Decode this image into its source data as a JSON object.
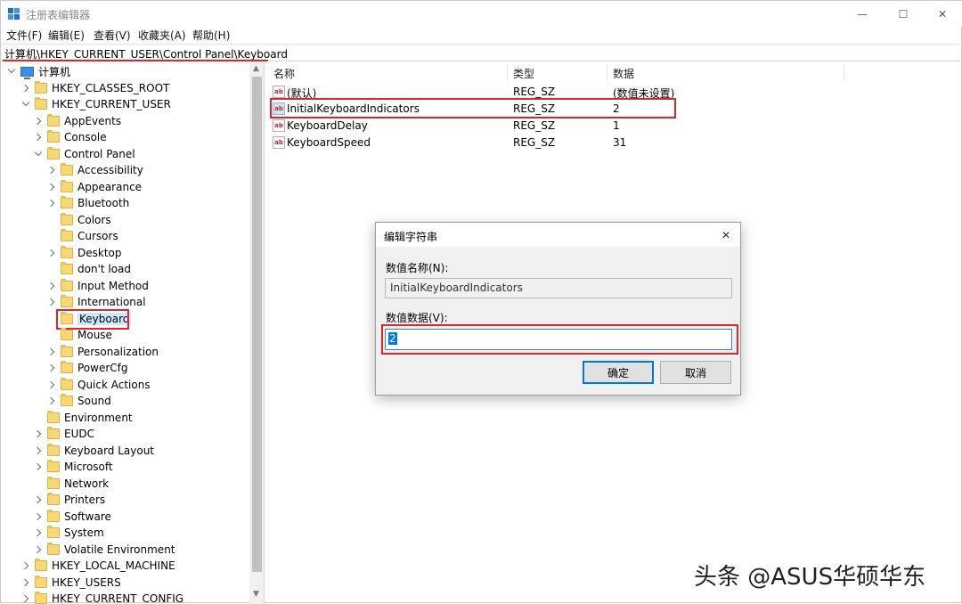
{
  "window": {
    "title": "注册表编辑器",
    "controls": {
      "minimize": "—",
      "maximize": "☐",
      "close": "✕"
    }
  },
  "menubar": {
    "items": [
      "文件(F)",
      "编辑(E)",
      "查看(V)",
      "收藏夹(A)",
      "帮助(H)"
    ]
  },
  "address": "计算机\\HKEY_CURRENT_USER\\Control Panel\\Keyboard",
  "tree": {
    "root": "计算机",
    "items": [
      "HKEY_CLASSES_ROOT",
      "HKEY_CURRENT_USER",
      "AppEvents",
      "Console",
      "Control Panel",
      "Accessibility",
      "Appearance",
      "Bluetooth",
      "Colors",
      "Cursors",
      "Desktop",
      "don't load",
      "Input Method",
      "International",
      "Keyboard",
      "Mouse",
      "Personalization",
      "PowerCfg",
      "Quick Actions",
      "Sound",
      "Environment",
      "EUDC",
      "Keyboard Layout",
      "Microsoft",
      "Network",
      "Printers",
      "Software",
      "System",
      "Volatile Environment",
      "HKEY_LOCAL_MACHINE",
      "HKEY_USERS",
      "HKEY_CURRENT_CONFIG"
    ],
    "selected": "Keyboard"
  },
  "list": {
    "columns": [
      "名称",
      "类型",
      "数据"
    ],
    "rows": [
      {
        "name": "(默认)",
        "type": "REG_SZ",
        "data": "(数值未设置)"
      },
      {
        "name": "InitialKeyboardIndicators",
        "type": "REG_SZ",
        "data": "2"
      },
      {
        "name": "KeyboardDelay",
        "type": "REG_SZ",
        "data": "1"
      },
      {
        "name": "KeyboardSpeed",
        "type": "REG_SZ",
        "data": "31"
      }
    ],
    "value_icon_text": "ab"
  },
  "dialog": {
    "title": "编辑字符串",
    "name_label": "数值名称(N):",
    "name_value": "InitialKeyboardIndicators",
    "data_label": "数值数据(V):",
    "data_value": "2",
    "ok_label": "确定",
    "cancel_label": "取消"
  },
  "watermark": "头条 @ASUS华硕华东",
  "colors": {
    "highlight_red": "#e0242b",
    "selection_blue": "#0078d7",
    "folder_yellow": "#f8d775"
  }
}
